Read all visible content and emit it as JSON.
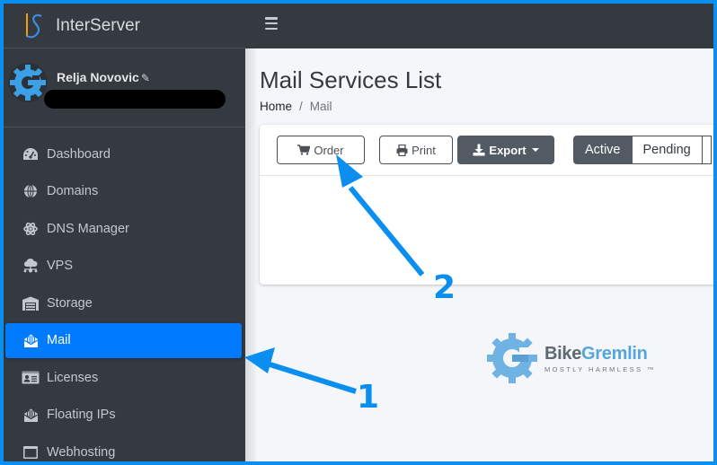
{
  "brand": {
    "name": "InterServer"
  },
  "user": {
    "name": "Relja Novovic",
    "edit_icon": "pencil-icon"
  },
  "topbar": {
    "menu_icon": "hamburger-icon"
  },
  "sidebar": {
    "items": [
      {
        "label": "Dashboard",
        "icon": "tachometer-icon",
        "active": false
      },
      {
        "label": "Domains",
        "icon": "globe-icon",
        "active": false
      },
      {
        "label": "DNS Manager",
        "icon": "atom-icon",
        "active": false
      },
      {
        "label": "VPS",
        "icon": "cloud-network-icon",
        "active": false
      },
      {
        "label": "Storage",
        "icon": "warehouse-icon",
        "active": false
      },
      {
        "label": "Mail",
        "icon": "envelope-open-text-icon",
        "active": true
      },
      {
        "label": "Licenses",
        "icon": "id-card-icon",
        "active": false
      },
      {
        "label": "Floating IPs",
        "icon": "envelope-open-icon",
        "active": false
      },
      {
        "label": "Webhosting",
        "icon": "window-icon",
        "active": false
      }
    ]
  },
  "page": {
    "title": "Mail Services List",
    "breadcrumb": {
      "home": "Home",
      "separator": "/",
      "current": "Mail"
    }
  },
  "toolbar": {
    "order_label": "Order",
    "print_label": "Print",
    "export_label": "Export",
    "filters": [
      {
        "label": "Active",
        "selected": true
      },
      {
        "label": "Pending",
        "selected": false
      }
    ]
  },
  "watermark": {
    "title_part1": "Bike",
    "title_part2": "Gremlin",
    "subtitle": "MOSTLY HARMLESS ™"
  },
  "annotations": {
    "arrow1_label": "1",
    "arrow2_label": "2",
    "color": "#0a8ff0"
  },
  "colors": {
    "sidebar_bg": "#343a40",
    "active_item": "#007bff",
    "frame_border": "#0a8ff0",
    "button_dark": "#525b63"
  }
}
